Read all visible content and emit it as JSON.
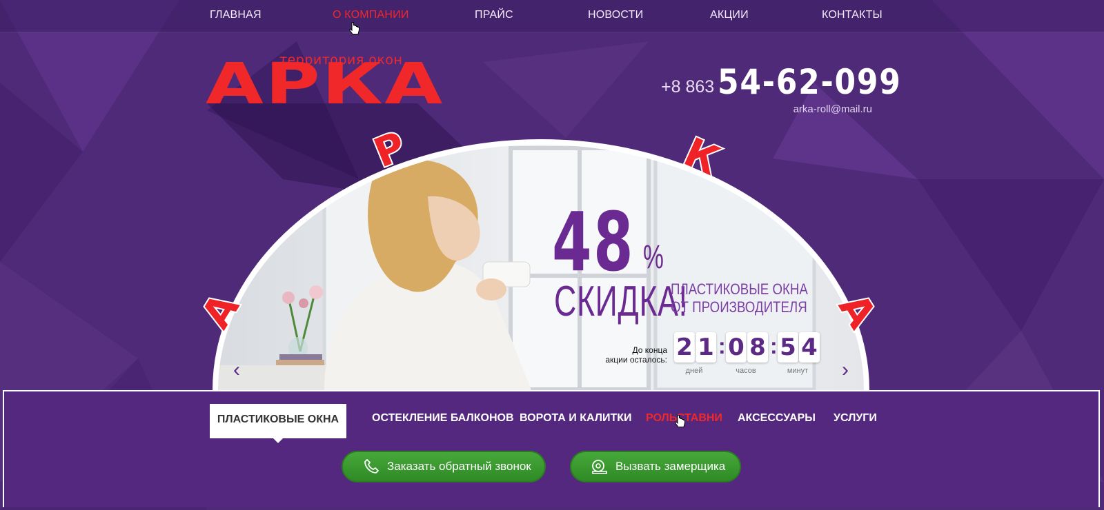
{
  "topnav": {
    "items": [
      {
        "label": "ГЛАВНАЯ"
      },
      {
        "label": "О КОМПАНИИ"
      },
      {
        "label": "ПРАЙС"
      },
      {
        "label": "НОВОСТИ"
      },
      {
        "label": "АКЦИИ"
      },
      {
        "label": "КОНТАКТЫ"
      }
    ],
    "active_index": 1
  },
  "logo": {
    "tagline": "территория окон",
    "name": "АРКА"
  },
  "contacts": {
    "phone_prefix": "+8 863",
    "phone_number": "54-62-099",
    "email": "arka-roll@mail.ru"
  },
  "arch_letters": [
    "А",
    "Р",
    "К",
    "А"
  ],
  "promo": {
    "percent_value": "48",
    "percent_sign": "%",
    "discount_label": "СКИДКА!",
    "description_line1": "ПЛАСТИКОВЫЕ ОКНА",
    "description_line2": "ОТ ПРОИЗВОДИТЕЛЯ",
    "timer_label_line1": "До конца",
    "timer_label_line2": "акции осталось:",
    "timer": {
      "days": [
        "2",
        "1"
      ],
      "hours": [
        "0",
        "8"
      ],
      "minutes": [
        "5",
        "4"
      ],
      "separator": ":",
      "days_label": "дней",
      "hours_label": "часов",
      "minutes_label": "минут"
    }
  },
  "slider": {
    "prev_icon": "chevron-left-icon",
    "next_icon": "chevron-right-icon",
    "prev_glyph": "‹",
    "next_glyph": "›"
  },
  "category_tabs": {
    "items": [
      {
        "label": "ПЛАСТИКОВЫЕ ОКНА"
      },
      {
        "label": "ОСТЕКЛЕНИЕ БАЛКОНОВ"
      },
      {
        "label": "ВОРОТА И КАЛИТКИ"
      },
      {
        "label": "РОЛЬСТАВНИ"
      },
      {
        "label": "АКСЕССУАРЫ"
      },
      {
        "label": "УСЛУГИ"
      }
    ],
    "active_index": 0,
    "hover_index": 3
  },
  "actions": {
    "callback_label": "Заказать обратный звонок",
    "callback_icon": "phone-icon",
    "measurer_label": "Вызвать замерщика",
    "measurer_icon": "tape-measure-icon"
  },
  "colors": {
    "background": "#4f2a78",
    "accent_red": "#f0282a",
    "promo_purple": "#6a2a92",
    "button_green": "#3a9a30"
  }
}
